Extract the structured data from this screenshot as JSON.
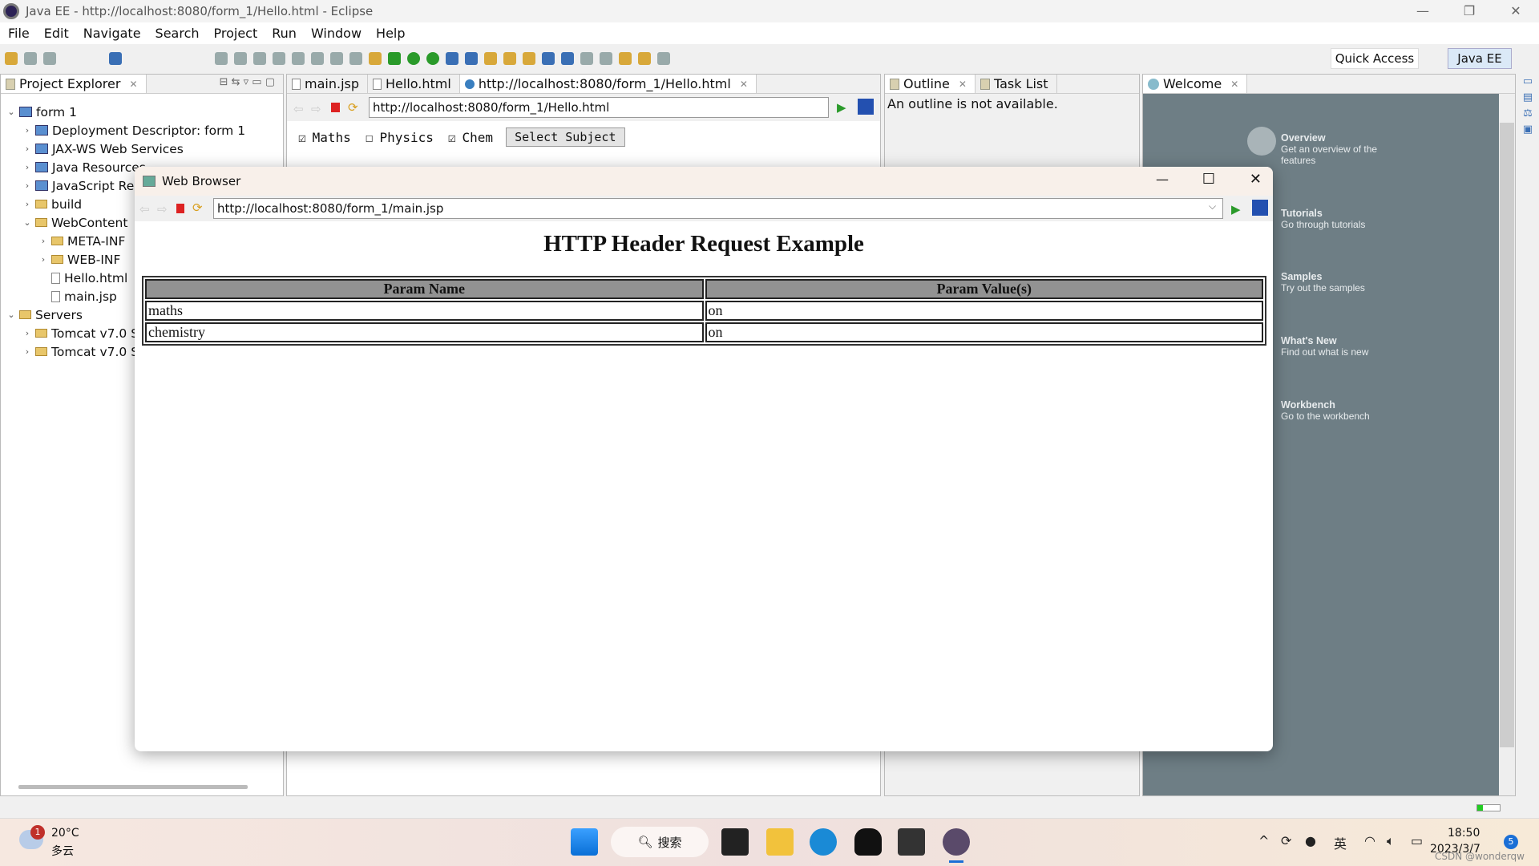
{
  "window": {
    "title": "Java EE - http://localhost:8080/form_1/Hello.html - Eclipse"
  },
  "menu": [
    "File",
    "Edit",
    "Navigate",
    "Search",
    "Project",
    "Run",
    "Window",
    "Help"
  ],
  "toolbar": {
    "quick_access": "Quick Access",
    "perspective": "Java EE"
  },
  "project_explorer": {
    "tab": "Project Explorer",
    "items": [
      {
        "label": "form 1",
        "depth": 0,
        "chev": "v",
        "icon": "project"
      },
      {
        "label": "Deployment Descriptor: form 1",
        "depth": 1,
        "chev": ">",
        "icon": "descriptor"
      },
      {
        "label": "JAX-WS Web Services",
        "depth": 1,
        "chev": ">",
        "icon": "webservice"
      },
      {
        "label": "Java Resources",
        "depth": 1,
        "chev": ">",
        "icon": "java-resources"
      },
      {
        "label": "JavaScript Resources",
        "depth": 1,
        "chev": ">",
        "icon": "js-resources"
      },
      {
        "label": "build",
        "depth": 1,
        "chev": ">",
        "icon": "folder"
      },
      {
        "label": "WebContent",
        "depth": 1,
        "chev": "v",
        "icon": "folder"
      },
      {
        "label": "META-INF",
        "depth": 2,
        "chev": ">",
        "icon": "folder"
      },
      {
        "label": "WEB-INF",
        "depth": 2,
        "chev": ">",
        "icon": "folder"
      },
      {
        "label": "Hello.html",
        "depth": 2,
        "chev": "",
        "icon": "file"
      },
      {
        "label": "main.jsp",
        "depth": 2,
        "chev": "",
        "icon": "file"
      },
      {
        "label": "Servers",
        "depth": 0,
        "chev": "v",
        "icon": "folder"
      },
      {
        "label": "Tomcat v7.0 Server",
        "depth": 1,
        "chev": ">",
        "icon": "folder"
      },
      {
        "label": "Tomcat v7.0 Server",
        "depth": 1,
        "chev": ">",
        "icon": "folder"
      }
    ]
  },
  "editor": {
    "tabs": [
      "main.jsp",
      "Hello.html",
      "http://localhost:8080/form_1/Hello.html"
    ],
    "active_tab": 2,
    "url": "http://localhost:8080/form_1/Hello.html",
    "form": {
      "checkboxes": [
        {
          "label": "Maths",
          "checked": true
        },
        {
          "label": "Physics",
          "checked": false
        },
        {
          "label": "Chem",
          "checked": true
        }
      ],
      "button": "Select Subject"
    }
  },
  "outline": {
    "tabs": [
      "Outline",
      "Task List"
    ],
    "message": "An outline is not available."
  },
  "welcome": {
    "tab": "Welcome",
    "items": [
      {
        "title": "Overview",
        "desc": "Get an overview of the features"
      },
      {
        "title": "Tutorials",
        "desc": "Go through tutorials"
      },
      {
        "title": "Samples",
        "desc": "Try out the samples"
      },
      {
        "title": "What's New",
        "desc": "Find out what is new"
      },
      {
        "title": "Workbench",
        "desc": "Go to the workbench"
      }
    ]
  },
  "browser_dialog": {
    "title": "Web Browser",
    "url": "http://localhost:8080/form_1/main.jsp",
    "heading": "HTTP Header Request Example",
    "table": {
      "headers": [
        "Param Name",
        "Param Value(s)"
      ],
      "rows": [
        [
          "maths",
          "on"
        ],
        [
          "chemistry",
          "on"
        ]
      ]
    }
  },
  "taskbar": {
    "weather_temp": "20°C",
    "weather_desc": "多云",
    "weather_badge": "1",
    "search": "搜索",
    "ime": "英",
    "time": "18:50",
    "date": "2023/3/7",
    "notif_count": "5",
    "watermark": "CSDN @wonderqw"
  }
}
